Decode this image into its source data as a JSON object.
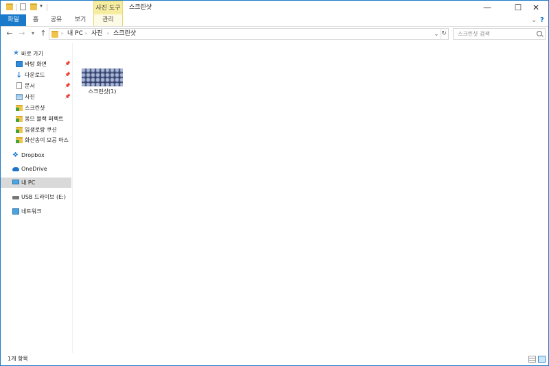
{
  "title_bar": {
    "context_tab_group": "사진 도구",
    "window_title": "스크린샷",
    "minimize_glyph": "—",
    "maximize_glyph": "☐",
    "close_glyph": "✕"
  },
  "ribbon_tabs": [
    {
      "label": "파일"
    },
    {
      "label": "홈"
    },
    {
      "label": "공유"
    },
    {
      "label": "보기"
    },
    {
      "label": "관리"
    }
  ],
  "address_bar": {
    "breadcrumbs": [
      "내 PC",
      "사진",
      "스크린샷"
    ],
    "search_placeholder": "스크린샷 검색"
  },
  "nav_pane": {
    "items": [
      {
        "label": "바로 가기",
        "icon": "star-icon"
      },
      {
        "label": "바탕 화면",
        "icon": "desktop-icon",
        "pinned": true
      },
      {
        "label": "다운로드",
        "icon": "download-icon",
        "pinned": true
      },
      {
        "label": "문서",
        "icon": "document-icon",
        "pinned": true
      },
      {
        "label": "사진",
        "icon": "pictures-icon",
        "pinned": true
      },
      {
        "label": "스크린샷",
        "icon": "folder-icon"
      },
      {
        "label": "옹므 블랙 퍼펙트",
        "icon": "folder-icon"
      },
      {
        "label": "임생로랑 쿠션",
        "icon": "folder-icon"
      },
      {
        "label": "화산송이 모공 마스",
        "icon": "folder-icon"
      },
      {
        "label": "Dropbox",
        "icon": "dropbox-icon"
      },
      {
        "label": "OneDrive",
        "icon": "onedrive-icon"
      },
      {
        "label": "내 PC",
        "icon": "computer-icon",
        "selected": true
      },
      {
        "label": "USB 드라이브 (E:)",
        "icon": "usb-drive-icon"
      },
      {
        "label": "네트워크",
        "icon": "network-icon"
      }
    ]
  },
  "content": {
    "files": [
      {
        "name": "스크린샷(1)",
        "thumbnail": "blueberries"
      }
    ]
  },
  "status_bar": {
    "item_count": "1개 항목"
  },
  "colors": {
    "accent": "#1979ca",
    "context_tab": "#f7eda0",
    "selection": "#d9d9d9"
  }
}
